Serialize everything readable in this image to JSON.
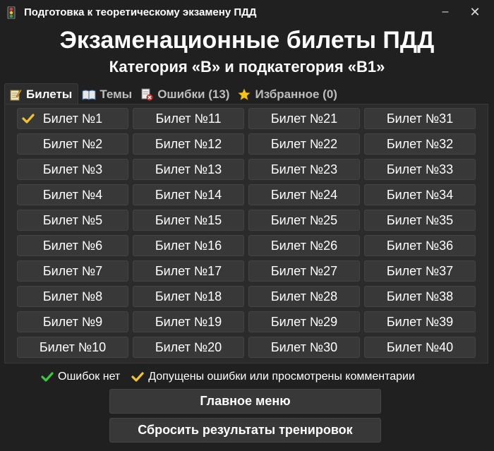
{
  "window": {
    "title": "Подготовка к теоретическому экзамену ПДД",
    "app_icon": "traffic-light-icon",
    "minimize_glyph": "–",
    "close_glyph": "✕"
  },
  "header": {
    "title": "Экзаменационные билеты ПДД",
    "subtitle": "Категория «B» и подкатегория «B1»"
  },
  "tabs": [
    {
      "label": "Билеты",
      "icon": "notepad-pencil-icon",
      "active": true
    },
    {
      "label": "Темы",
      "icon": "open-book-icon",
      "active": false
    },
    {
      "label": "Ошибки (13)",
      "icon": "error-document-icon",
      "active": false
    },
    {
      "label": "Избранное (0)",
      "icon": "star-icon",
      "active": false
    }
  ],
  "tickets": {
    "columns": [
      [
        {
          "label": "Билет №1",
          "status": "errors-or-viewed"
        },
        {
          "label": "Билет №2"
        },
        {
          "label": "Билет №3"
        },
        {
          "label": "Билет №4"
        },
        {
          "label": "Билет №5"
        },
        {
          "label": "Билет №6"
        },
        {
          "label": "Билет №7"
        },
        {
          "label": "Билет №8"
        },
        {
          "label": "Билет №9"
        },
        {
          "label": "Билет №10"
        }
      ],
      [
        {
          "label": "Билет №11"
        },
        {
          "label": "Билет №12"
        },
        {
          "label": "Билет №13"
        },
        {
          "label": "Билет №14"
        },
        {
          "label": "Билет №15"
        },
        {
          "label": "Билет №16"
        },
        {
          "label": "Билет №17"
        },
        {
          "label": "Билет №18"
        },
        {
          "label": "Билет №19"
        },
        {
          "label": "Билет №20"
        }
      ],
      [
        {
          "label": "Билет №21"
        },
        {
          "label": "Билет №22"
        },
        {
          "label": "Билет №23"
        },
        {
          "label": "Билет №24"
        },
        {
          "label": "Билет №25"
        },
        {
          "label": "Билет №26"
        },
        {
          "label": "Билет №27"
        },
        {
          "label": "Билет №28"
        },
        {
          "label": "Билет №29"
        },
        {
          "label": "Билет №30"
        }
      ],
      [
        {
          "label": "Билет №31"
        },
        {
          "label": "Билет №32"
        },
        {
          "label": "Билет №33"
        },
        {
          "label": "Билет №34"
        },
        {
          "label": "Билет №35"
        },
        {
          "label": "Билет №36"
        },
        {
          "label": "Билет №37"
        },
        {
          "label": "Билет №38"
        },
        {
          "label": "Билет №39"
        },
        {
          "label": "Билет №40"
        }
      ]
    ]
  },
  "legend": {
    "no_errors": "Ошибок нет",
    "errors_or_viewed": "Допущены ошибки или просмотрены комментарии"
  },
  "buttons": {
    "main_menu": "Главное меню",
    "reset": "Сбросить результаты тренировок"
  },
  "colors": {
    "background": "#202020",
    "panel": "#2b2b2b",
    "button": "#383838",
    "check_green": "#3cc83c",
    "check_yellow": "#f2c230"
  }
}
